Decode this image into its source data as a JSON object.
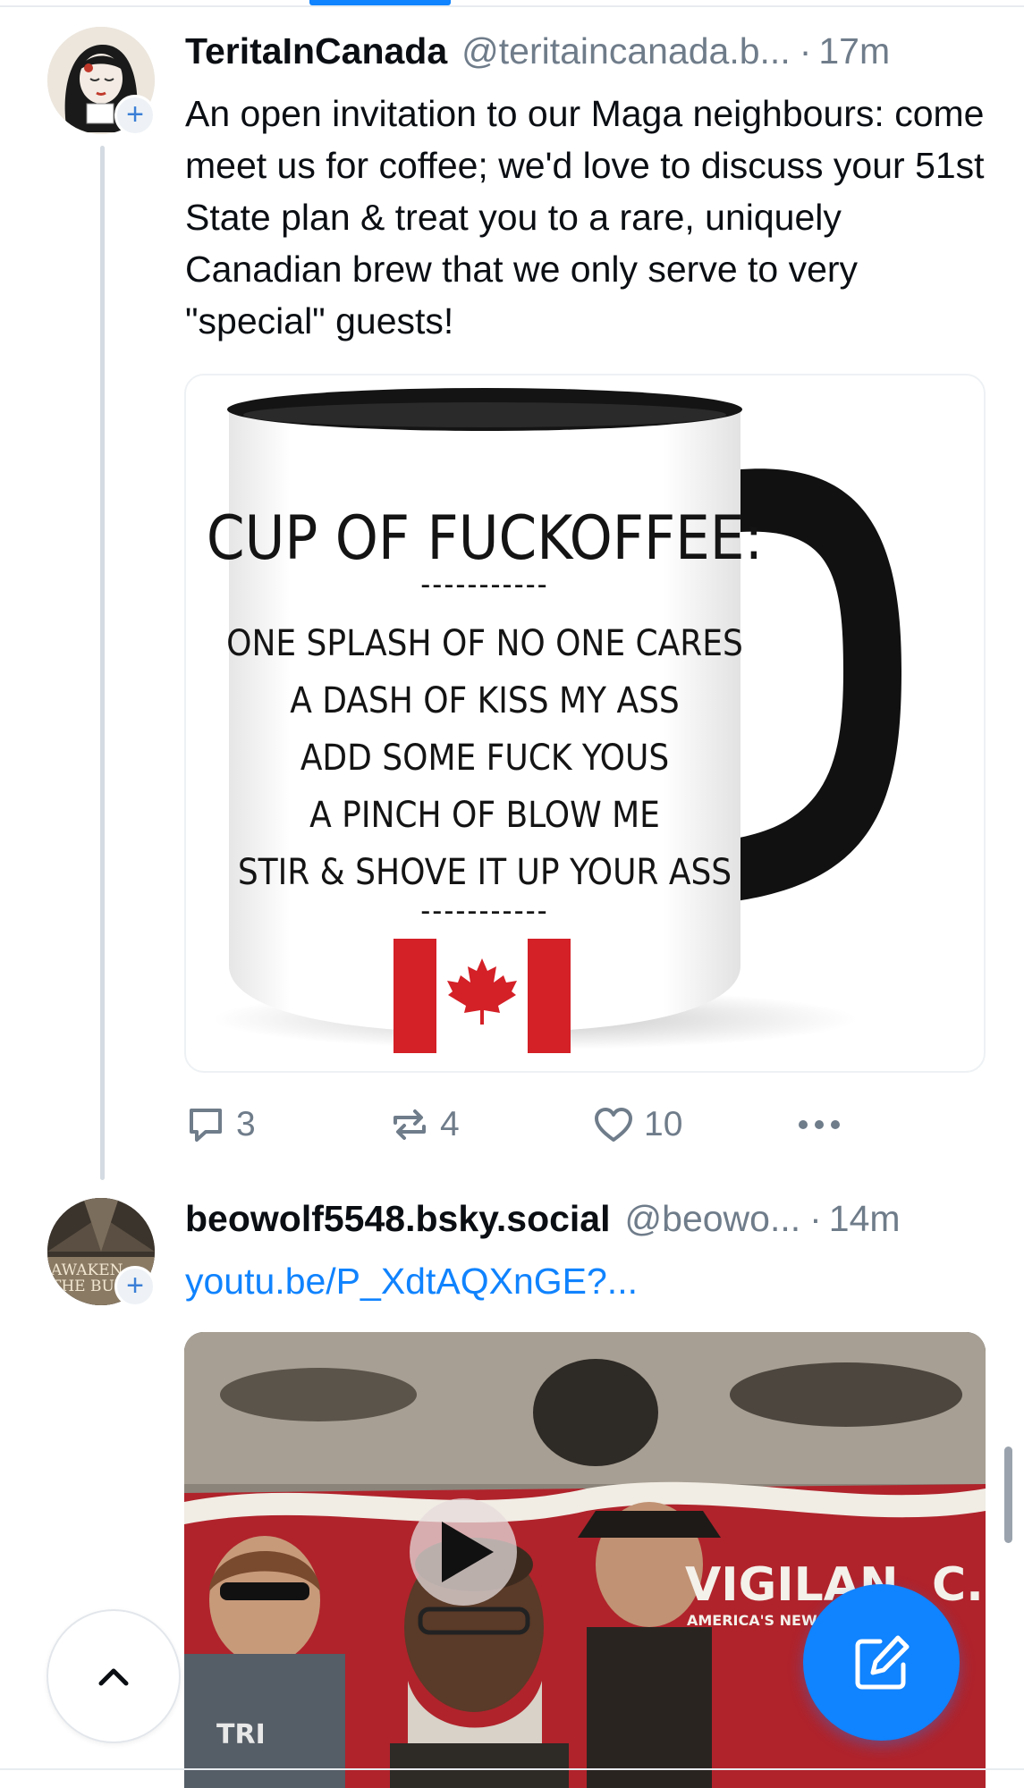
{
  "posts": [
    {
      "display_name": "TeritaInCanada",
      "handle": "@teritaincanada.b...",
      "separator": "·",
      "time": "17m",
      "text": "An open invitation to our Maga neighbours: come meet us for coffee; we'd love to discuss your 51st State plan & treat you to a rare, uniquely Canadian brew that we only serve to very \"special\" guests!",
      "image": {
        "mug_title": "CUP OF FUCKOFFEE:",
        "mug_divider": "-----------",
        "mug_lines": [
          "ONE SPLASH OF NO ONE CARES",
          "A DASH OF KISS MY ASS",
          "ADD SOME FUCK YOUS",
          "A PINCH OF BLOW ME",
          "STIR & SHOVE IT UP YOUR ASS"
        ]
      },
      "actions": {
        "replies": "3",
        "reposts": "4",
        "likes": "10"
      }
    },
    {
      "display_name": "beowolf5548.bsky.social",
      "handle": "@beowo...",
      "separator": "·",
      "time": "14m",
      "link": "youtu.be/P_XdtAQXnGE?...",
      "avatar_text": [
        "AWAKEN",
        "THE BUI"
      ],
      "video": {
        "overlay_title": "VIGILAN",
        "overlay_title_end": "C.",
        "overlay_subtitle": "AMERICA'S NEW",
        "shirt_text": "TRI"
      }
    }
  ],
  "icons": {
    "reply": "speech-bubble",
    "repost": "repost-arrows",
    "like": "heart",
    "more": "ellipsis",
    "scroll_top": "chevron-up",
    "compose": "pencil-square"
  },
  "colors": {
    "accent": "#1083fe",
    "muted": "#6f7c8a",
    "thread_line": "#d4dbe2"
  }
}
